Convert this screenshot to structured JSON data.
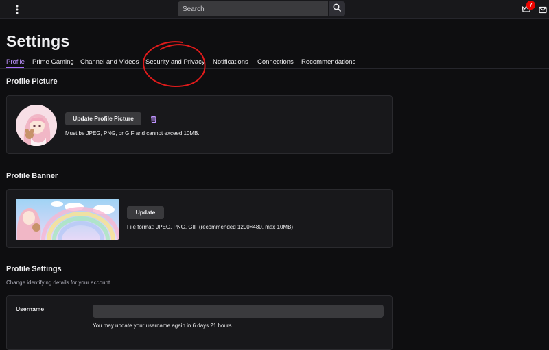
{
  "header": {
    "search": {
      "placeholder": "Search",
      "value": ""
    },
    "notifications": {
      "count": "7"
    }
  },
  "page": {
    "title": "Settings"
  },
  "tabs": [
    {
      "label": "Profile",
      "active": true
    },
    {
      "label": "Prime Gaming"
    },
    {
      "label": "Channel and Videos"
    },
    {
      "label": "Security and Privacy"
    },
    {
      "label": "Notifications"
    },
    {
      "label": "Connections"
    },
    {
      "label": "Recommendations"
    }
  ],
  "profile_picture": {
    "title": "Profile Picture",
    "update_label": "Update Profile Picture",
    "hint": "Must be JPEG, PNG, or GIF and cannot exceed 10MB."
  },
  "profile_banner": {
    "title": "Profile Banner",
    "update_label": "Update",
    "hint": "File format: JPEG, PNG, GIF (recommended 1200×480, max 10MB)"
  },
  "profile_settings": {
    "title": "Profile Settings",
    "subtitle": "Change identifying details for your account",
    "username_label": "Username",
    "username_value": "",
    "username_hint": "You may update your username again in 6 days 21 hours"
  },
  "colors": {
    "accent": "#a970ff",
    "accent_text": "#bf94ff",
    "annotation": "#e01b1b",
    "badge": "#eb0400"
  }
}
